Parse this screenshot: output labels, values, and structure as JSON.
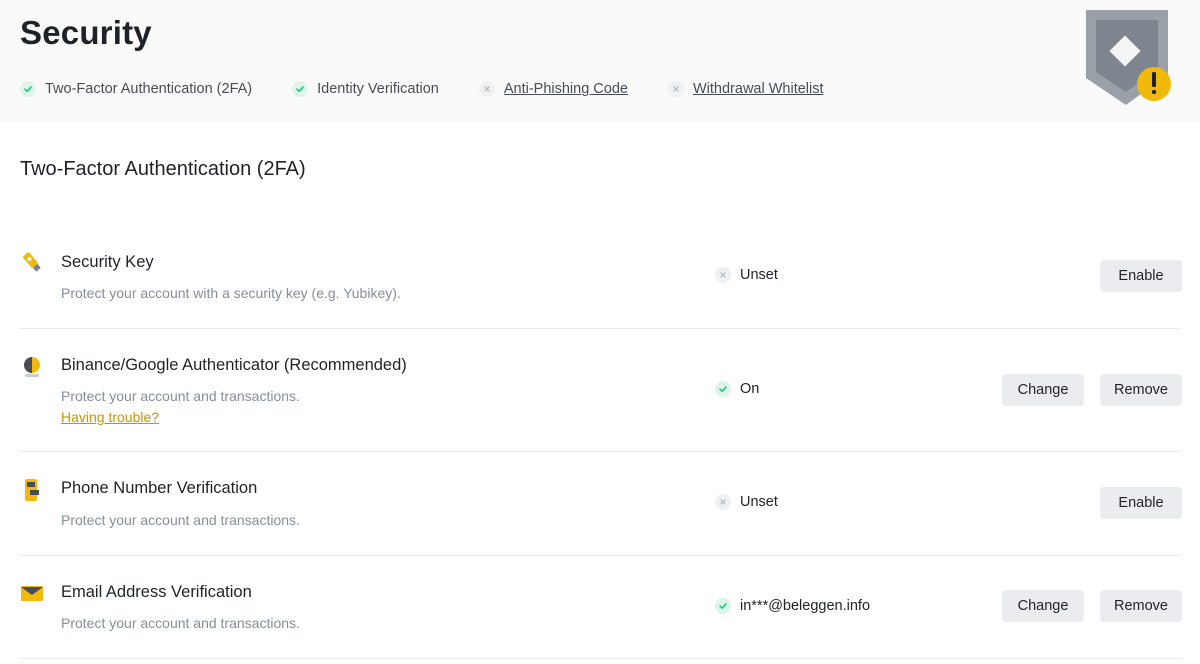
{
  "header": {
    "title": "Security",
    "status_items": [
      {
        "label": "Two-Factor Authentication (2FA)",
        "state": "done"
      },
      {
        "label": "Identity Verification",
        "state": "done"
      },
      {
        "label": "Anti-Phishing Code",
        "state": "missing"
      },
      {
        "label": "Withdrawal Whitelist",
        "state": "missing"
      }
    ]
  },
  "section": {
    "title": "Two-Factor Authentication (2FA)"
  },
  "rows": [
    {
      "icon": "usb-key-icon",
      "title": "Security Key",
      "description": "Protect your account with a security key (e.g. Yubikey).",
      "status": "Unset",
      "status_state": "unset",
      "buttons": [
        "Enable"
      ]
    },
    {
      "icon": "authenticator-icon",
      "title": "Binance/Google Authenticator (Recommended)",
      "description": "Protect your account and transactions.",
      "link": "Having trouble?",
      "status": "On",
      "status_state": "on",
      "buttons": [
        "Change",
        "Remove"
      ]
    },
    {
      "icon": "phone-icon",
      "title": "Phone Number Verification",
      "description": "Protect your account and transactions.",
      "status": "Unset",
      "status_state": "unset",
      "buttons": [
        "Enable"
      ]
    },
    {
      "icon": "envelope-icon",
      "title": "Email Address Verification",
      "description": "Protect your account and transactions.",
      "status": "in***@beleggen.info",
      "status_state": "on",
      "buttons": [
        "Change",
        "Remove"
      ]
    }
  ],
  "colors": {
    "accent": "#f0b90b",
    "link": "#c99400",
    "check_green": "#0ecb81",
    "muted_text": "#848e9c",
    "button_bg": "#eaecef",
    "shield_gray": "#8a8f98"
  }
}
